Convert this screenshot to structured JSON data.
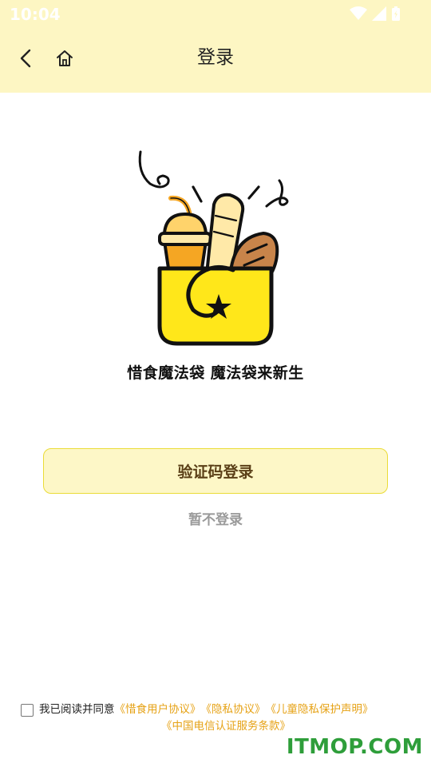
{
  "status_bar": {
    "time": "10:04"
  },
  "header": {
    "title": "登录"
  },
  "slogan": "惜食魔法袋  魔法袋来新生",
  "login_button": {
    "label": "验证码登录"
  },
  "skip_link": {
    "label": "暂不登录"
  },
  "agreement": {
    "prefix": "我已阅读并同意",
    "links": [
      "《惜食用户协议》",
      "《隐私协议》",
      "《儿童隐私保护声明》",
      "《中国电信认证服务条款》"
    ]
  },
  "watermark": "ITMOP.COM",
  "colors": {
    "header_bg": "#fdf6c3",
    "button_bg": "#fdf7c7",
    "link": "#e6a215",
    "bag_yellow": "#ffe71a"
  }
}
